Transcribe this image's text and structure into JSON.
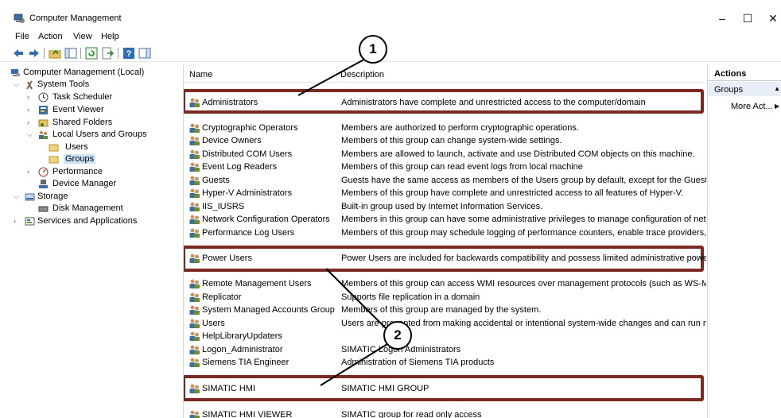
{
  "window": {
    "title": "Computer Management",
    "controls": {
      "minimize": "–",
      "maximize": "☐",
      "close": "✕"
    }
  },
  "menu": [
    "File",
    "Action",
    "View",
    "Help"
  ],
  "tree": {
    "root": "Computer Management (Local)",
    "system_tools": "System Tools",
    "task_scheduler": "Task Scheduler",
    "event_viewer": "Event Viewer",
    "shared_folders": "Shared Folders",
    "local_users_groups": "Local Users and Groups",
    "users": "Users",
    "groups": "Groups",
    "performance": "Performance",
    "device_manager": "Device Manager",
    "storage": "Storage",
    "disk_management": "Disk Management",
    "services_apps": "Services and Applications"
  },
  "list": {
    "col_name": "Name",
    "col_desc": "Description",
    "rows": [
      {
        "name": "Administrators",
        "desc": "Administrators have complete and unrestricted access to the computer/domain"
      },
      {
        "name": "Cryptographic Operators",
        "desc": "Members are authorized to perform cryptographic operations."
      },
      {
        "name": "Device Owners",
        "desc": "Members of this group can change system-wide settings."
      },
      {
        "name": "Distributed COM Users",
        "desc": "Members are allowed to launch, activate and use Distributed COM objects on this machine."
      },
      {
        "name": "Event Log Readers",
        "desc": "Members of this group can read event logs from local machine"
      },
      {
        "name": "Guests",
        "desc": "Guests have the same access as members of the Users group by default, except for the Guest account"
      },
      {
        "name": "Hyper-V Administrators",
        "desc": "Members of this group have complete and unrestricted access to all features of Hyper-V."
      },
      {
        "name": "IIS_IUSRS",
        "desc": "Built-in group used by Internet Information Services."
      },
      {
        "name": "Network Configuration Operators",
        "desc": "Members in this group can have some administrative privileges to manage configuration of networki"
      },
      {
        "name": "Performance Log Users",
        "desc": "Members of this group may schedule logging of performance counters, enable trace providers, and c"
      },
      {
        "name": "Power Users",
        "desc": "Power Users are included for backwards compatibility and possess limited administrative powers"
      },
      {
        "name": "Remote Management Users",
        "desc": "Members of this group can access WMI resources over management protocols (such as WS-Manager"
      },
      {
        "name": "Replicator",
        "desc": "Supports file replication in a domain"
      },
      {
        "name": "System Managed Accounts Group",
        "desc": "Members of this group are managed by the system."
      },
      {
        "name": "Users",
        "desc": "Users are prevented from making accidental or intentional system-wide changes and can run most ap"
      },
      {
        "name": "HelpLibraryUpdaters",
        "desc": ""
      },
      {
        "name": "Logon_Administrator",
        "desc": "SIMATIC Logon Administrators"
      },
      {
        "name": "Siemens TIA Engineer",
        "desc": "Administration of Siemens TIA products"
      },
      {
        "name": "SIMATIC HMI",
        "desc": "SIMATIC HMI GROUP"
      },
      {
        "name": "SIMATIC HMI VIEWER",
        "desc": "SIMATIC group for read only access"
      }
    ]
  },
  "actions": {
    "header": "Actions",
    "group": "Groups",
    "more": "More Act..."
  },
  "callouts": [
    "1",
    "2"
  ],
  "colors": {
    "highlight_border": "#7b2a22",
    "selection": "#cce4f7"
  }
}
